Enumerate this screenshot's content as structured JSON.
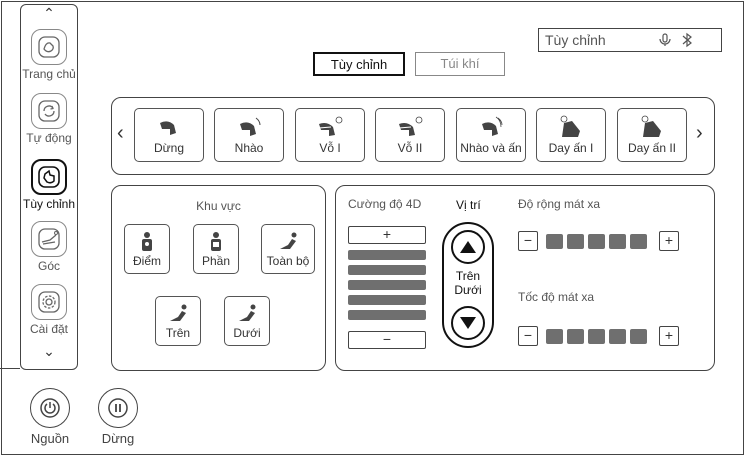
{
  "sidebar": {
    "items": [
      {
        "label": "Trang chủ",
        "icon": "home-hand-icon",
        "active": false
      },
      {
        "label": "Tự động",
        "icon": "auto-cycle-icon",
        "active": false
      },
      {
        "label": "Tùy chỉnh",
        "icon": "custom-hand-icon",
        "active": true
      },
      {
        "label": "Góc",
        "icon": "recline-angle-icon",
        "active": false
      },
      {
        "label": "Cài đặt",
        "icon": "gear-icon",
        "active": false
      }
    ],
    "up_arrow": "⌃",
    "down_arrow": "⌄"
  },
  "status": {
    "mode_text": "Tùy chỉnh",
    "icons": [
      "voice-icon",
      "bluetooth-icon"
    ]
  },
  "tabs": [
    {
      "label": "Tùy chỉnh",
      "active": true
    },
    {
      "label": "Túi khí",
      "active": false
    }
  ],
  "programs": {
    "prev": "‹",
    "next": "›",
    "items": [
      {
        "label": "Dừng",
        "icon": "stop-hand-icon"
      },
      {
        "label": "Nhào",
        "icon": "knead-icon"
      },
      {
        "label": "Vỗ I",
        "icon": "tap-1-icon"
      },
      {
        "label": "Vỗ II",
        "icon": "tap-2-icon"
      },
      {
        "label": "Nhào và ấn",
        "icon": "knead-press-icon"
      },
      {
        "label": "Day ấn I",
        "icon": "shiatsu-1-icon"
      },
      {
        "label": "Day ấn II",
        "icon": "shiatsu-2-icon"
      }
    ]
  },
  "area": {
    "title": "Khu vực",
    "buttons": [
      {
        "label": "Điểm",
        "icon": "point-body-icon"
      },
      {
        "label": "Phần",
        "icon": "partial-body-icon"
      },
      {
        "label": "Toàn bộ",
        "icon": "full-body-icon"
      },
      {
        "label": "Trên",
        "icon": "upper-body-icon"
      },
      {
        "label": "Dưới",
        "icon": "lower-body-icon"
      }
    ]
  },
  "controls": {
    "intensity_label": "Cường độ 4D",
    "plus": "+",
    "minus": "−",
    "intensity_level": 5,
    "intensity_max": 5,
    "position_label": "Vị trí",
    "position_upper": "Trên",
    "position_lower": "Dưới",
    "width_label": "Độ rộng mát xa",
    "width_level": 5,
    "width_max": 5,
    "speed_label": "Tốc độ mát xa",
    "speed_level": 5,
    "speed_max": 5
  },
  "bottom": {
    "power_label": "Nguồn",
    "stop_label": "Dừng"
  }
}
